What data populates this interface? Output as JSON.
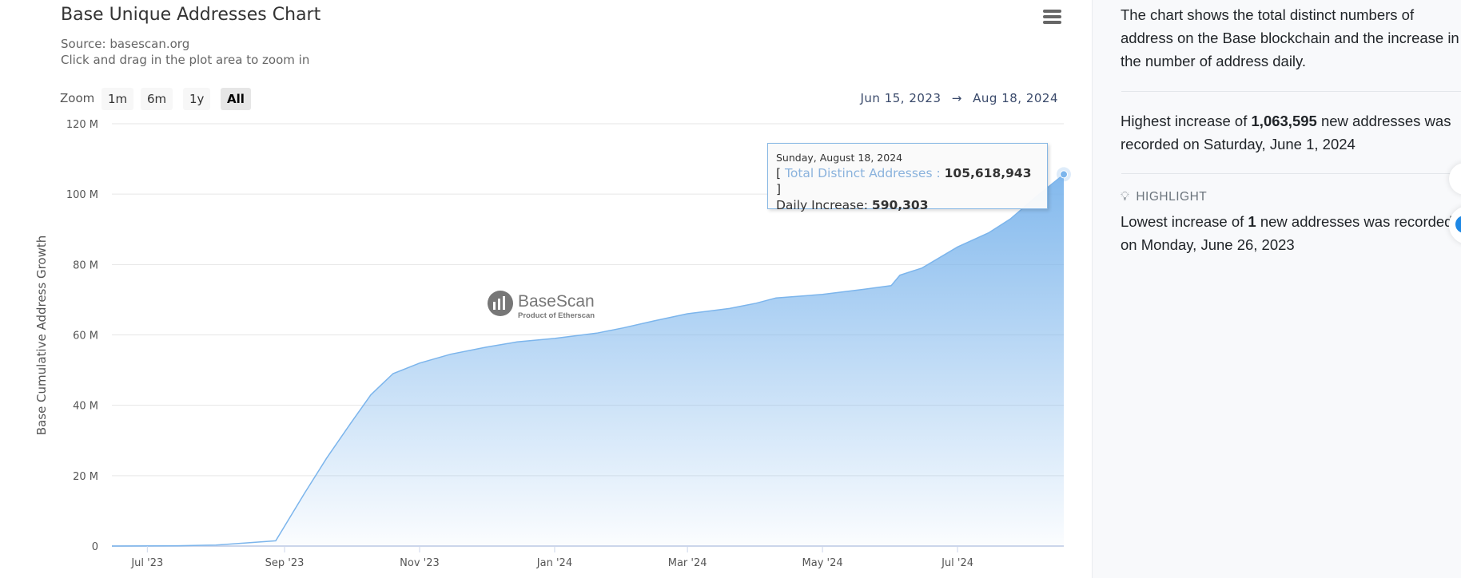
{
  "chart_header": {
    "title": "Base Unique Addresses Chart",
    "source": "Source: basescan.org",
    "hint": "Click and drag in the plot area to zoom in"
  },
  "zoom": {
    "label": "Zoom",
    "buttons": [
      "1m",
      "6m",
      "1y",
      "All"
    ],
    "selected": "All"
  },
  "range": {
    "from": "Jun 15, 2023",
    "arrow": "→",
    "to": "Aug 18, 2024"
  },
  "watermark": {
    "name": "BaseScan",
    "tagline": "Product of Etherscan"
  },
  "tooltip": {
    "date": "Sunday, August 18, 2024",
    "open": "[",
    "series": "Total Distinct Addresses",
    "sep": ":",
    "value": "105,618,943",
    "close": "]",
    "daily_label": "Daily Increase:",
    "daily_value": "590,303"
  },
  "chart_data": {
    "type": "area",
    "title": "Base Unique Addresses Chart",
    "ylabel": "Base Cumulative Address Growth",
    "xlabel": "",
    "ylim": [
      0,
      120000000
    ],
    "xlim": [
      "2023-06-15",
      "2024-08-18"
    ],
    "yticks": [
      0,
      20000000,
      40000000,
      60000000,
      80000000,
      100000000,
      120000000
    ],
    "ytick_labels": [
      "0",
      "20 M",
      "40 M",
      "60 M",
      "80 M",
      "100 M",
      "120 M"
    ],
    "xticks": [
      "2023-07-01",
      "2023-09-01",
      "2023-11-01",
      "2024-01-01",
      "2024-03-01",
      "2024-05-01",
      "2024-07-01"
    ],
    "xtick_labels": [
      "Jul '23",
      "Sep '23",
      "Nov '23",
      "Jan '24",
      "Mar '24",
      "May '24",
      "Jul '24"
    ],
    "grid": true,
    "color": "#7cb5ec",
    "series": [
      {
        "name": "Total Distinct Addresses",
        "x": [
          "2023-06-15",
          "2023-07-15",
          "2023-08-01",
          "2023-08-15",
          "2023-08-28",
          "2023-09-10",
          "2023-09-20",
          "2023-10-01",
          "2023-10-10",
          "2023-10-20",
          "2023-11-01",
          "2023-11-15",
          "2023-12-01",
          "2023-12-15",
          "2024-01-01",
          "2024-01-20",
          "2024-02-01",
          "2024-02-15",
          "2024-03-01",
          "2024-03-20",
          "2024-04-01",
          "2024-04-10",
          "2024-05-01",
          "2024-05-20",
          "2024-06-01",
          "2024-06-05",
          "2024-06-15",
          "2024-07-01",
          "2024-07-15",
          "2024-07-25",
          "2024-08-05",
          "2024-08-18"
        ],
        "values": [
          0,
          100000,
          300000,
          900000,
          1500000,
          15000000,
          25000000,
          35000000,
          43000000,
          49000000,
          52000000,
          54500000,
          56500000,
          58000000,
          59000000,
          60500000,
          62000000,
          64000000,
          66000000,
          67500000,
          69000000,
          70500000,
          71500000,
          73000000,
          74000000,
          77000000,
          79000000,
          85000000,
          89000000,
          93000000,
          99000000,
          105618943
        ]
      }
    ],
    "highlighted_point": {
      "x": "2024-08-18",
      "y": 105618943
    }
  },
  "side": {
    "desc": "The chart shows the total distinct numbers of address on the Base blockchain and the increase in the number of address daily.",
    "high_pre": "Highest increase of ",
    "high_val": "1,063,595",
    "high_post": " new addresses was recorded on Saturday, June 1, 2024",
    "highlight_label": "HIGHLIGHT",
    "low_pre": "Lowest increase of ",
    "low_val": "1",
    "low_post": " new addresses was recorded on Monday, June 26, 2023"
  }
}
